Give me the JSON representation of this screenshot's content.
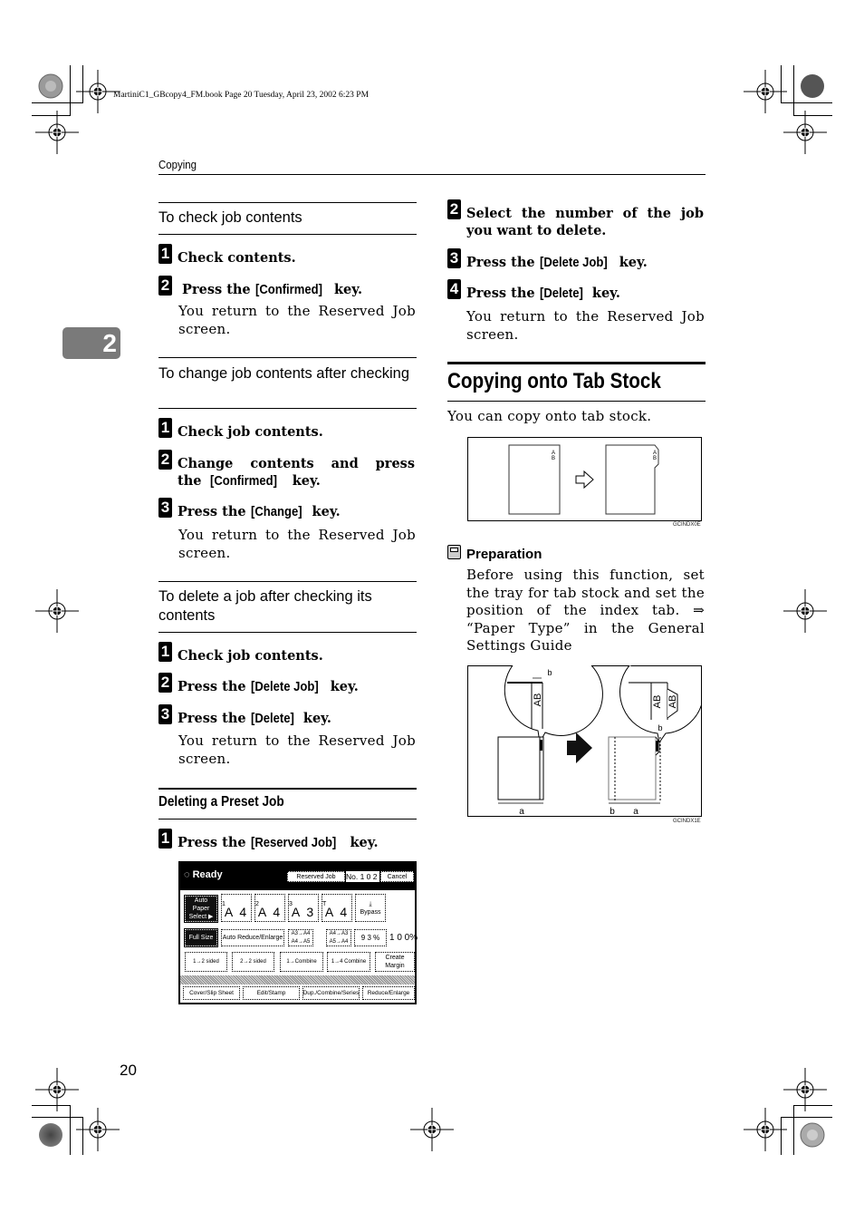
{
  "slug": "MartiniC1_GBcopy4_FM.book  Page 20  Tuesday, April 23, 2002  6:23 PM",
  "running_header": "Copying",
  "chapter_tab": "2",
  "page_number": "20",
  "left_column": {
    "sections": [
      {
        "title": "To check job contents",
        "steps": [
          {
            "num": "1",
            "text": "Check contents."
          },
          {
            "num": "2",
            "pre": " Press the ",
            "key": "[Confirmed]",
            "post": " key."
          }
        ],
        "result": "You return to the Reserved Job screen."
      },
      {
        "title": "To change job contents after checking",
        "steps": [
          {
            "num": "1",
            "text": "Check job contents."
          },
          {
            "num": "2",
            "pre": "Change contents and press the ",
            "key": "[Confirmed]",
            "post": " key."
          },
          {
            "num": "3",
            "pre": "Press the ",
            "key": "[Change]",
            "post": " key."
          }
        ],
        "result": "You return to the Reserved Job screen."
      },
      {
        "title": "To delete a job after checking its contents",
        "steps": [
          {
            "num": "1",
            "text": "Check job contents."
          },
          {
            "num": "2",
            "pre": "Press the ",
            "key": "[Delete Job]",
            "post": " key."
          },
          {
            "num": "3",
            "pre": "Press the ",
            "key": "[Delete]",
            "post": " key."
          }
        ],
        "result": "You return to the Reserved Job screen."
      },
      {
        "title": "Deleting a Preset Job",
        "steps": [
          {
            "num": "1",
            "pre": "Press the ",
            "key": "[Reserved Job]",
            "post": " key."
          }
        ]
      }
    ]
  },
  "panel": {
    "status": "Ready",
    "reserved_job": "Reserved Job",
    "job_no": "No. 1 0 2",
    "cancel": "Cancel",
    "auto_paper": "Auto Paper Select ▶",
    "trays": [
      {
        "label": "1",
        "size": "A 4"
      },
      {
        "label": "2",
        "size": "A 4"
      },
      {
        "label": "3",
        "size": "A 3"
      },
      {
        "label": "T",
        "size": "A 4"
      }
    ],
    "bypass": "Bypass",
    "full_size": "Full Size",
    "auto_reduce": "Auto Reduce/Enlarge",
    "ratio1": "A3→A4 A4→A5",
    "ratio2": "A4→A3 A5→A4",
    "zoom_val": "9 3 %",
    "ratio_display": "1 0 0%",
    "duplex_modes": [
      "1→2 sided",
      "2→2 sided",
      "1→Combine",
      "1→4 Combine"
    ],
    "create_margin": "Create Margin",
    "bottom_tabs": [
      "Cover/Slip Sheet",
      "Edit/Stamp",
      "Dup./Combine/Series",
      "Reduce/Enlarge"
    ]
  },
  "right_column": {
    "steps": [
      {
        "num": "2",
        "text": "Select the number of the job you want to delete."
      },
      {
        "num": "3",
        "pre": "Press the ",
        "key": "[Delete Job]",
        "post": " key."
      },
      {
        "num": "4",
        "pre": "Press the ",
        "key": "[Delete]",
        "post": " key."
      }
    ],
    "result": "You return to the Reserved Job screen.",
    "heading": "Copying onto Tab Stock",
    "intro": "You can copy onto tab stock.",
    "figure1": {
      "label_a": "A",
      "label_b": "B",
      "caption": "GCINDX0E"
    },
    "preparation": {
      "title": "Preparation",
      "text": "Before using this function, set the tray for tab stock and set the position of the index tab. ⇒ “Paper Type” in the General Settings Guide"
    },
    "figure2": {
      "label_ab": "AB",
      "dim_a": "a",
      "dim_b": "b",
      "caption": "GCINDX1E"
    }
  }
}
